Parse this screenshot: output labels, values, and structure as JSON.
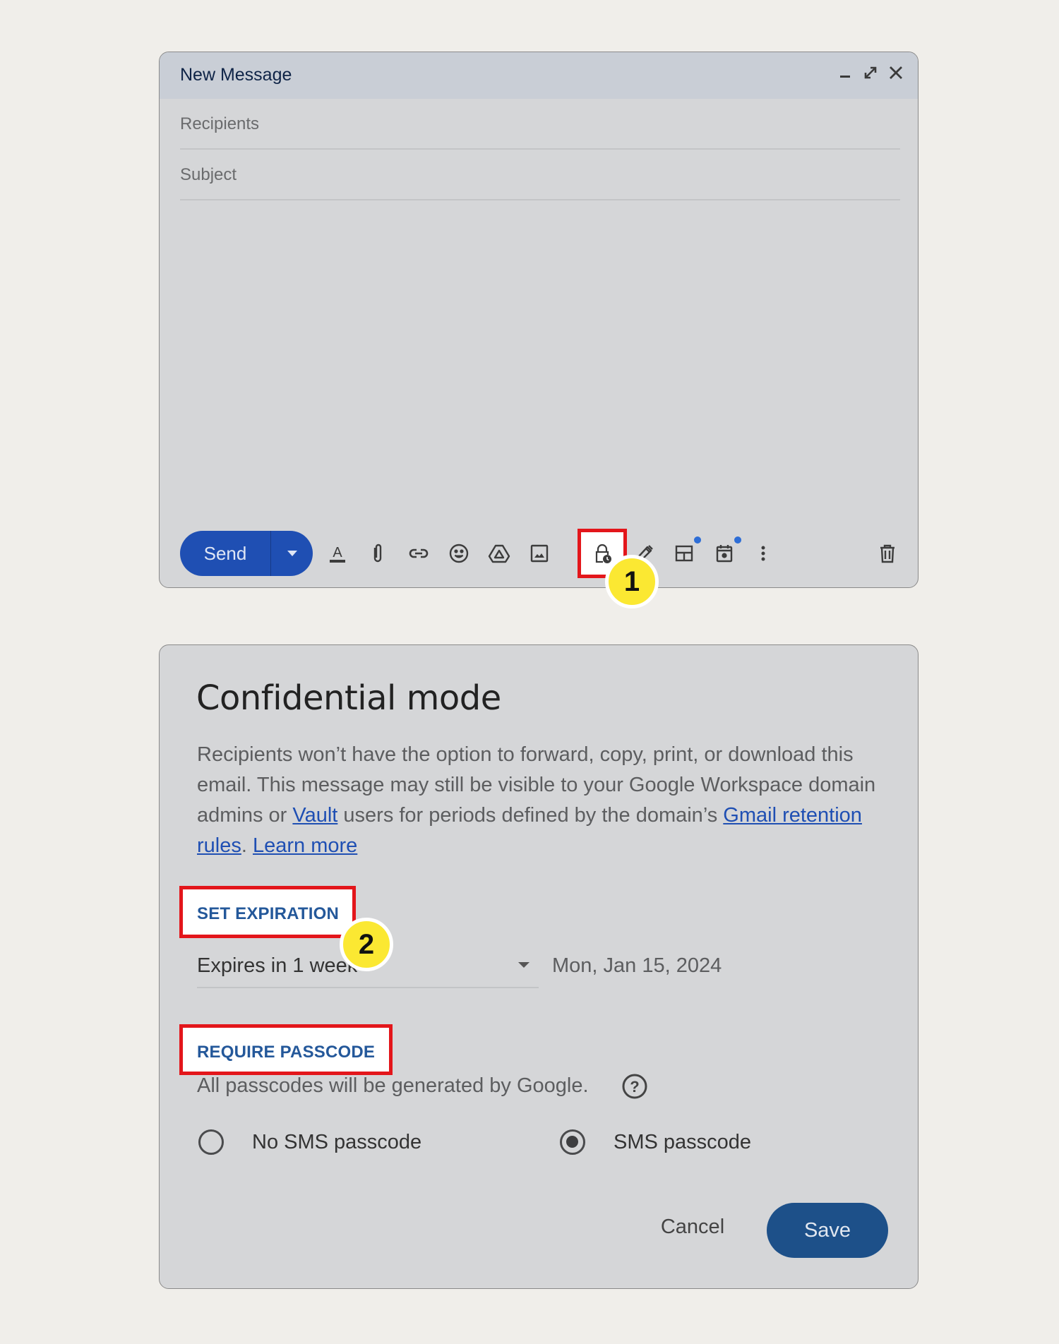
{
  "compose": {
    "title": "New Message",
    "window_controls": [
      "minimize-icon",
      "pop-out-icon",
      "close-icon"
    ],
    "recipients_placeholder": "Recipients",
    "subject_placeholder": "Subject",
    "toolbar": {
      "send_label": "Send",
      "send_options_icon": "caret-down-icon",
      "icons": [
        "text-format-icon",
        "attach-icon",
        "link-icon",
        "emoji-icon",
        "drive-icon",
        "image-icon",
        "confidential-mode-icon",
        "signature-pen-icon",
        "layouts-icon",
        "schedule-event-icon",
        "more-options-icon",
        "discard-icon"
      ],
      "new_feature_dots": [
        "layouts-icon",
        "schedule-event-icon"
      ]
    },
    "annotation_badge": "1"
  },
  "dialog": {
    "title": "Confidential mode",
    "description": {
      "part1": "Recipients won’t have the option to forward, copy, print, or download this email. This message may still be visible to your Google Workspace domain admins or ",
      "link_vault": "Vault",
      "part2": " users for periods defined by the domain’s ",
      "link_retention": "Gmail retention rules",
      "part3": ". ",
      "link_learn": "Learn more"
    },
    "expiration": {
      "label": "SET EXPIRATION",
      "selected": "Expires in 1 week",
      "date": "Mon, Jan 15, 2024",
      "annotation_badge": "2"
    },
    "passcode": {
      "label": "REQUIRE PASSCODE",
      "note": "All passcodes will be generated by Google.",
      "options": [
        {
          "label": "No SMS passcode",
          "selected": false
        },
        {
          "label": "SMS passcode",
          "selected": true
        }
      ]
    },
    "buttons": {
      "cancel": "Cancel",
      "save": "Save"
    }
  },
  "colors": {
    "background": "#f0eeea",
    "panel": "#d5d6d8",
    "header": "#c9ced6",
    "send_button": "#1f4fb3",
    "save_button": "#1d5089",
    "link": "#1f4fb3",
    "section_label": "#24589a",
    "highlight": "#e3161b",
    "badge": "#fbe832"
  }
}
